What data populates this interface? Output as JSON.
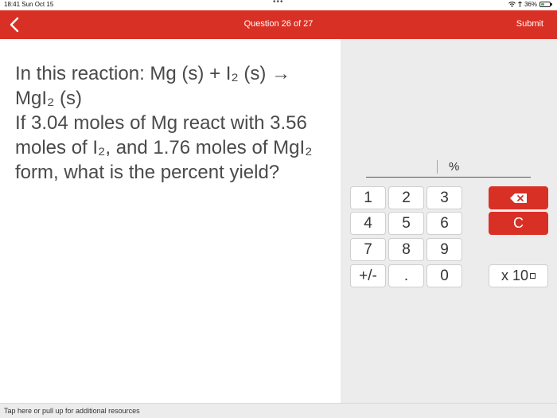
{
  "status_bar": {
    "time_date": "18:41  Sun Oct 15",
    "more_dots": "•••",
    "battery_percent": "36%",
    "battery_level": 0.36
  },
  "header": {
    "title": "Question 26 of 27",
    "submit_label": "Submit"
  },
  "question": {
    "line1": "In this reaction: Mg (s) + I₂ (s) →",
    "line2": "MgI₂ (s)",
    "line3": "If 3.04 moles of Mg react with 3.56",
    "line4": "moles of I₂, and 1.76 moles of MgI₂",
    "line5": "form, what is the percent yield?"
  },
  "answer": {
    "value": "",
    "unit": "%"
  },
  "keypad": {
    "k1": "1",
    "k2": "2",
    "k3": "3",
    "k4": "4",
    "k5": "5",
    "k6": "6",
    "k7": "7",
    "k8": "8",
    "k9": "9",
    "sign": "+/-",
    "dot": ".",
    "k0": "0",
    "clear": "C",
    "sci": "x 10"
  },
  "footer": {
    "resources": "Tap here or pull up for additional resources"
  },
  "colors": {
    "accent": "#d93025",
    "panel": "#ececec"
  }
}
